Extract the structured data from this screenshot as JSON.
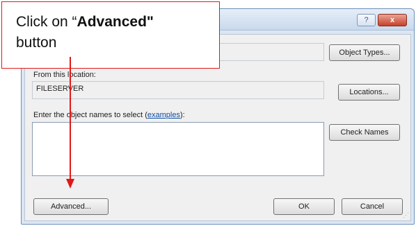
{
  "callout": {
    "line1_prefix": "Click on “",
    "line1_bold": "Advanced",
    "line1_suffix": "\"",
    "line2": "button"
  },
  "titlebar": {
    "help_glyph": "?",
    "close_glyph": "x"
  },
  "object_types_button": "Object Types...",
  "from_location": {
    "label": "From this location:",
    "value": "FILESERVER"
  },
  "locations_button": "Locations...",
  "enter_names": {
    "label_prefix": "Enter the object names to select (",
    "link": "examples",
    "label_suffix": "):",
    "value": ""
  },
  "check_names_button": "Check Names",
  "advanced_button": "Advanced...",
  "ok_button": "OK",
  "cancel_button": "Cancel",
  "colors": {
    "callout_border": "#e01818",
    "link": "#0b4ea2",
    "close_button": "#c7402a"
  }
}
